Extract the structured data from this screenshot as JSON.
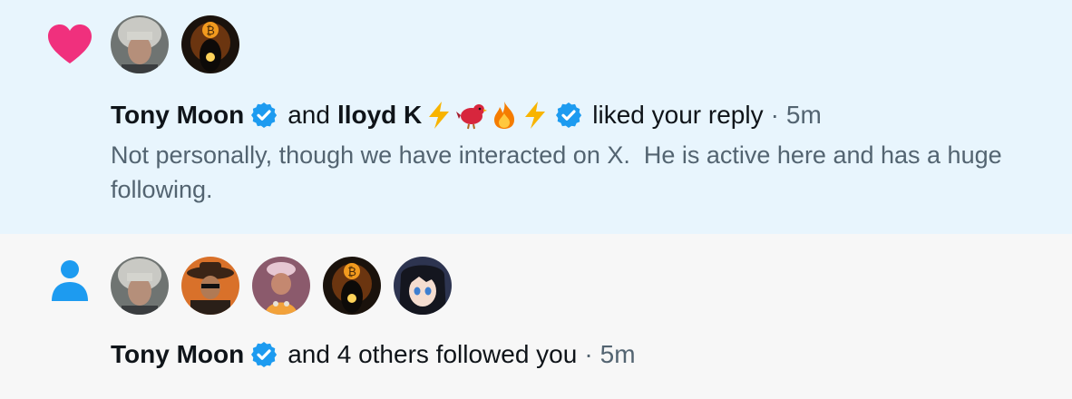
{
  "like_notification": {
    "actor1_name": "Tony Moon",
    "connector": "and",
    "actor2_name": "lloyd K",
    "actor2_emojis": [
      "lightning-emoji",
      "red-bird-emoji",
      "fire-emoji",
      "lightning-emoji"
    ],
    "action": "liked your reply",
    "separator": "·",
    "time": "5m",
    "snippet": "Not personally, though we have interacted on X.  He is active here and has a huge following."
  },
  "follow_notification": {
    "actor_name": "Tony Moon",
    "action": "and 4 others followed you",
    "separator": "·",
    "time": "5m"
  },
  "colors": {
    "like_bg": "#e8f5fd",
    "follow_bg": "#f7f7f7",
    "heart": "#f0307d",
    "person": "#1d9bf0",
    "verified": "#1d9bf0",
    "secondary_text": "#536471",
    "primary_text": "#0f1419"
  }
}
